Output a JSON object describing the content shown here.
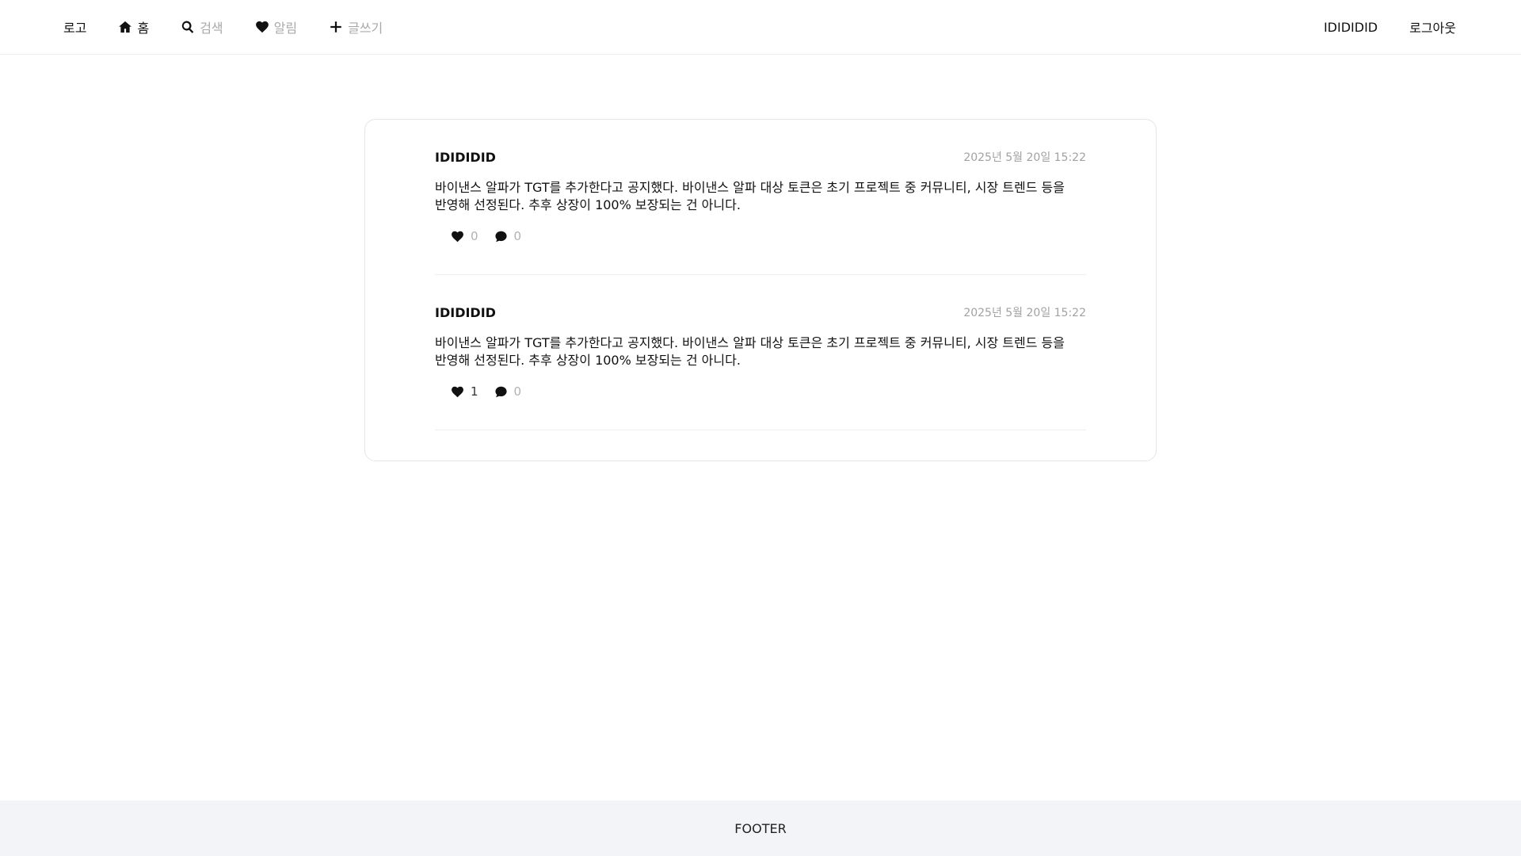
{
  "nav": {
    "logo": "로고",
    "items": [
      {
        "label": "홈",
        "icon": "home-icon"
      },
      {
        "label": "검색",
        "icon": "search-icon"
      },
      {
        "label": "알림",
        "icon": "heart-icon"
      },
      {
        "label": "글쓰기",
        "icon": "plus-icon"
      }
    ],
    "username": "IDIDIDID",
    "logout": "로그아웃"
  },
  "posts": [
    {
      "author": "IDIDIDID",
      "date": "2025년 5월 20일 15:22",
      "body": "바이낸스 알파가 TGT를 추가한다고 공지했다. 바이낸스 알파 대상 토큰은 초기 프로젝트 중 커뮤니티, 시장 트렌드 등을 반영해 선정된다. 추후 상장이 100% 보장되는 건 아니다.",
      "likes": "0",
      "comments": "0"
    },
    {
      "author": "IDIDIDID",
      "date": "2025년 5월 20일 15:22",
      "body": "바이낸스 알파가 TGT를 추가한다고 공지했다. 바이낸스 알파 대상 토큰은 초기 프로젝트 중 커뮤니티, 시장 트렌드 등을 반영해 선정된다. 추후 상장이 100% 보장되는 건 아니다.",
      "likes": "1",
      "comments": "0"
    }
  ],
  "footer": {
    "text": "FOOTER"
  },
  "colors": {
    "muted": "#a8a8a8",
    "border": "#e6e6e6",
    "footer_bg": "#f3f4f7"
  }
}
